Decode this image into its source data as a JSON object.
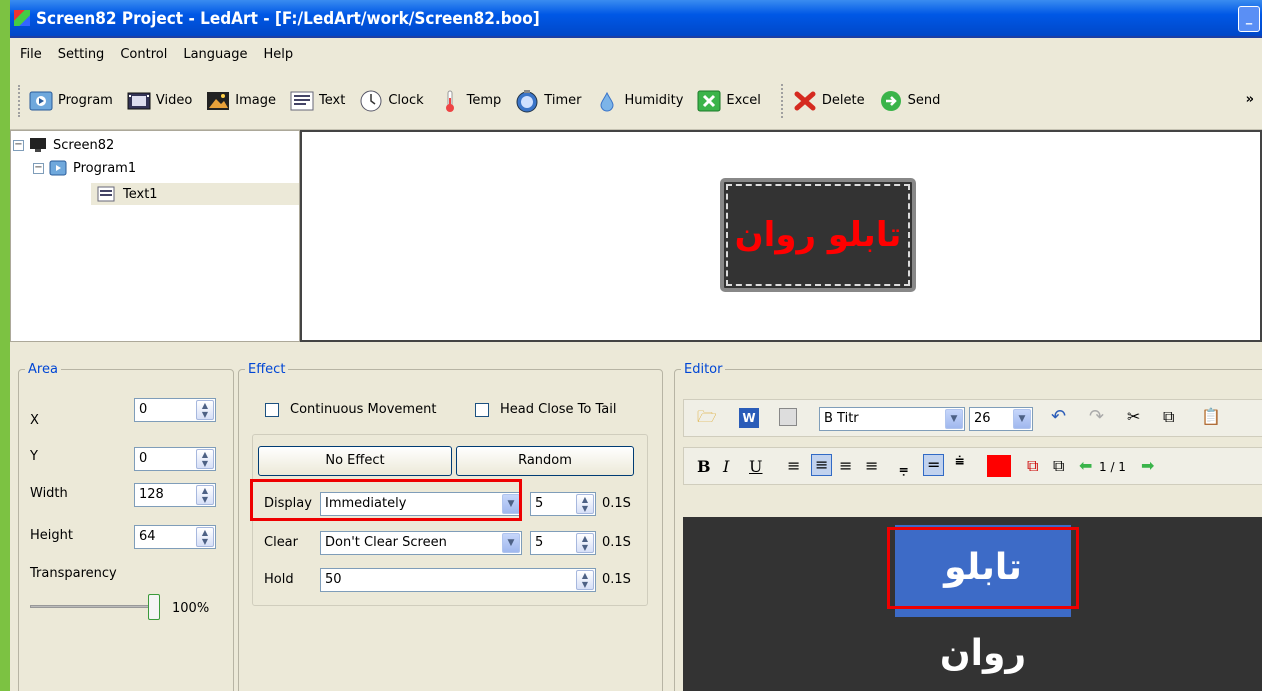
{
  "window": {
    "title": "Screen82 Project - LedArt - [F:/LedArt/work/Screen82.boo]"
  },
  "menu": [
    "File",
    "Setting",
    "Control",
    "Language",
    "Help"
  ],
  "toolbar": {
    "program": "Program",
    "video": "Video",
    "image": "Image",
    "text": "Text",
    "clock": "Clock",
    "temp": "Temp",
    "timer": "Timer",
    "humidity": "Humidity",
    "excel": "Excel",
    "delete": "Delete",
    "send": "Send",
    "more": "»"
  },
  "tree": {
    "screen": "Screen82",
    "program": "Program1",
    "text": "Text1"
  },
  "preview": {
    "led_text": "تابلو روان"
  },
  "area": {
    "legend": "Area",
    "x_label": "X",
    "x": "0",
    "y_label": "Y",
    "y": "0",
    "width_label": "Width",
    "width": "128",
    "height_label": "Height",
    "height": "64",
    "transparency_label": "Transparency",
    "transparency": "100%",
    "transparency_level": 1.0
  },
  "effect": {
    "legend": "Effect",
    "continuous": "Continuous Movement",
    "head_close": "Head Close To Tail",
    "no_effect": "No Effect",
    "random": "Random",
    "display_label": "Display",
    "display_value": "Immediately",
    "display_speed": "5",
    "display_unit": "0.1S",
    "clear_label": "Clear",
    "clear_value": "Don't Clear Screen",
    "clear_speed": "5",
    "clear_unit": "0.1S",
    "hold_label": "Hold",
    "hold_value": "50",
    "hold_unit": "0.1S"
  },
  "editor": {
    "legend": "Editor",
    "font": "B Titr",
    "size": "26",
    "bold": "B",
    "italic": "I",
    "underline": "U",
    "page": "1 / 1",
    "text": "تابلو روان",
    "color_red": "#ff0000"
  }
}
